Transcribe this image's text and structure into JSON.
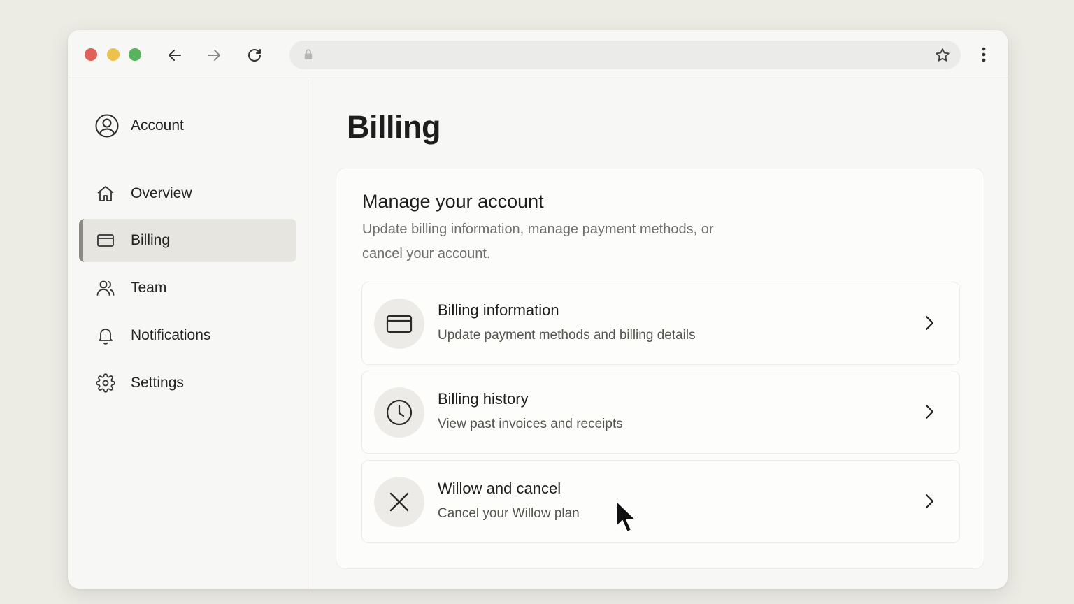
{
  "browser": {
    "address": "",
    "icons": [
      "back-arrow-icon",
      "forward-arrow-icon",
      "reload-icon",
      "lock-icon",
      "star-icon",
      "kebab-menu-icon"
    ]
  },
  "sidebar": {
    "account_label": "Account",
    "items": [
      {
        "label": "Overview",
        "icon": "home-icon",
        "active": false
      },
      {
        "label": "Billing",
        "icon": "credit-card-icon",
        "active": true
      },
      {
        "label": "Team",
        "icon": "users-icon",
        "active": false
      },
      {
        "label": "Notifications",
        "icon": "bell-icon",
        "active": false
      },
      {
        "label": "Settings",
        "icon": "gear-icon",
        "active": false
      }
    ]
  },
  "main": {
    "title": "Billing",
    "card": {
      "heading": "Manage your account",
      "description": "Update billing information, manage payment methods, or cancel your account.",
      "rows": [
        {
          "title": "Billing information",
          "subtitle": "Update payment methods and billing details",
          "icon": "credit-card-icon"
        },
        {
          "title": "Billing history",
          "subtitle": "View past invoices and receipts",
          "icon": "clock-icon"
        },
        {
          "title": "Willow and cancel",
          "subtitle": "Cancel your Willow plan",
          "icon": "close-icon"
        }
      ]
    }
  },
  "colors": {
    "background": "#ecebe4",
    "window": "#f7f7f5",
    "active_item": "#e7e5e0",
    "traffic_red": "#e0605a",
    "traffic_yellow": "#ecc24d",
    "traffic_green": "#59b35e"
  }
}
